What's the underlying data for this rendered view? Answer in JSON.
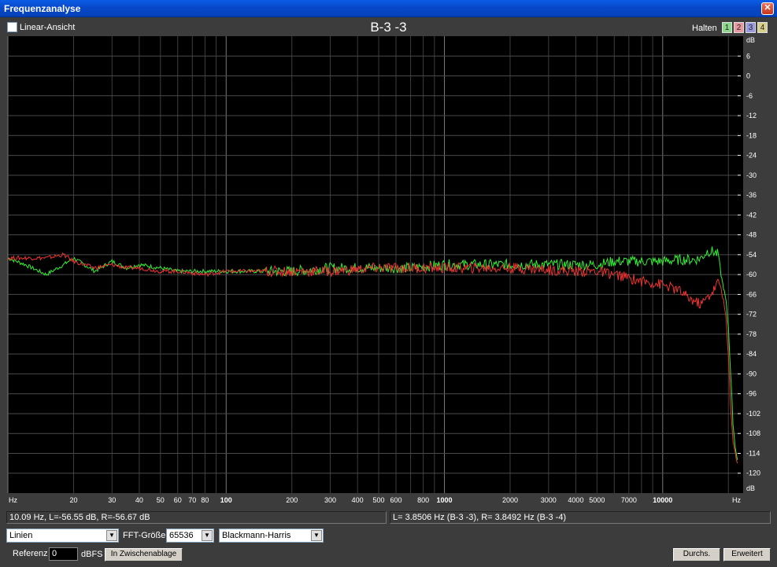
{
  "window": {
    "title": "Frequenzanalyse",
    "close_glyph": "✕"
  },
  "toolbar": {
    "linear_label": "Linear-Ansicht",
    "plot_title": "B-3 -3",
    "halten_label": "Halten",
    "hold_buttons": [
      {
        "label": "1",
        "color": "#8cd88c"
      },
      {
        "label": "2",
        "color": "#e89aa0"
      },
      {
        "label": "3",
        "color": "#9a9ae0"
      },
      {
        "label": "4",
        "color": "#d8d08a"
      }
    ]
  },
  "chart_data": {
    "type": "line",
    "title": "B-3 -3",
    "x_scale": "log",
    "xlim": [
      10,
      22050
    ],
    "ylim": [
      -126,
      12
    ],
    "x_unit_left": "Hz",
    "x_unit_right": "Hz",
    "y_unit": "dB",
    "x_ticks": [
      20,
      30,
      40,
      50,
      60,
      70,
      80,
      100,
      200,
      300,
      400,
      500,
      600,
      800,
      1000,
      2000,
      3000,
      4000,
      5000,
      7000,
      10000
    ],
    "x_tick_labels": [
      "20",
      "30",
      "40",
      "50",
      "60",
      "70",
      "80",
      "100",
      "200",
      "300",
      "400",
      "500",
      "600",
      "800",
      "1000",
      "2000",
      "3000",
      "4000",
      "5000",
      "7000",
      "10000"
    ],
    "y_ticks": [
      6,
      0,
      -6,
      -12,
      -18,
      -24,
      -30,
      -36,
      -42,
      -48,
      -54,
      -60,
      -66,
      -72,
      -78,
      -84,
      -90,
      -96,
      -102,
      -108,
      -114,
      -120
    ],
    "grid": true,
    "series": [
      {
        "color": "#33ee33",
        "x": [
          10,
          12,
          15,
          18,
          20,
          25,
          30,
          35,
          40,
          50,
          60,
          80,
          100,
          150,
          200,
          300,
          500,
          700,
          1000,
          1500,
          2000,
          3000,
          4000,
          5000,
          6000,
          7000,
          8000,
          10000,
          12000,
          14000,
          15000,
          16000,
          17000,
          18000,
          18500,
          19000,
          19500,
          20000,
          20500,
          21000,
          21500,
          22000
        ],
        "y": [
          -55,
          -57,
          -60,
          -57,
          -55,
          -59,
          -56,
          -58,
          -57,
          -58,
          -59,
          -59,
          -59,
          -59,
          -59,
          -58,
          -58,
          -58,
          -57,
          -57,
          -57,
          -57,
          -57,
          -57,
          -56,
          -56,
          -56,
          -56,
          -55.5,
          -55.5,
          -55,
          -53,
          -53,
          -54,
          -60,
          -64,
          -68,
          -76,
          -90,
          -105,
          -112,
          -116
        ]
      },
      {
        "color": "#ee3333",
        "x": [
          10,
          12,
          15,
          18,
          20,
          25,
          30,
          35,
          40,
          50,
          60,
          80,
          100,
          150,
          200,
          300,
          500,
          700,
          1000,
          1500,
          2000,
          3000,
          4000,
          5000,
          6000,
          7000,
          8000,
          10000,
          12000,
          13000,
          14000,
          15000,
          16000,
          17000,
          18000,
          18500,
          19000,
          19500,
          20000,
          20500,
          21000,
          21500,
          22000
        ],
        "y": [
          -55,
          -55,
          -55,
          -54,
          -56,
          -58,
          -57,
          -58,
          -58,
          -59,
          -59,
          -60,
          -59,
          -59,
          -59,
          -59,
          -58,
          -58,
          -58,
          -58,
          -58,
          -58.5,
          -59,
          -59,
          -60,
          -61,
          -62,
          -63,
          -65,
          -67,
          -68,
          -69,
          -67,
          -65,
          -62,
          -64,
          -68,
          -73,
          -85,
          -100,
          -110,
          -114,
          -117
        ]
      }
    ]
  },
  "status": {
    "left": "10.09 Hz, L=-56.55 dB, R=-56.67 dB",
    "right": "L= 3.8506 Hz (B-3 -3), R= 3.8492 Hz (B-3 -4)"
  },
  "controls": {
    "display_mode": "Linien",
    "fft_label": "FFT-Größe",
    "fft_size": "65536",
    "window_function": "Blackmann-Harris",
    "referenz_label": "Referenz",
    "referenz_value": "0",
    "dbfs_label": "dBFS",
    "clipboard_button": "In Zwischenablage",
    "durchs_button": "Durchs.",
    "erweitert_button": "Erweitert"
  }
}
